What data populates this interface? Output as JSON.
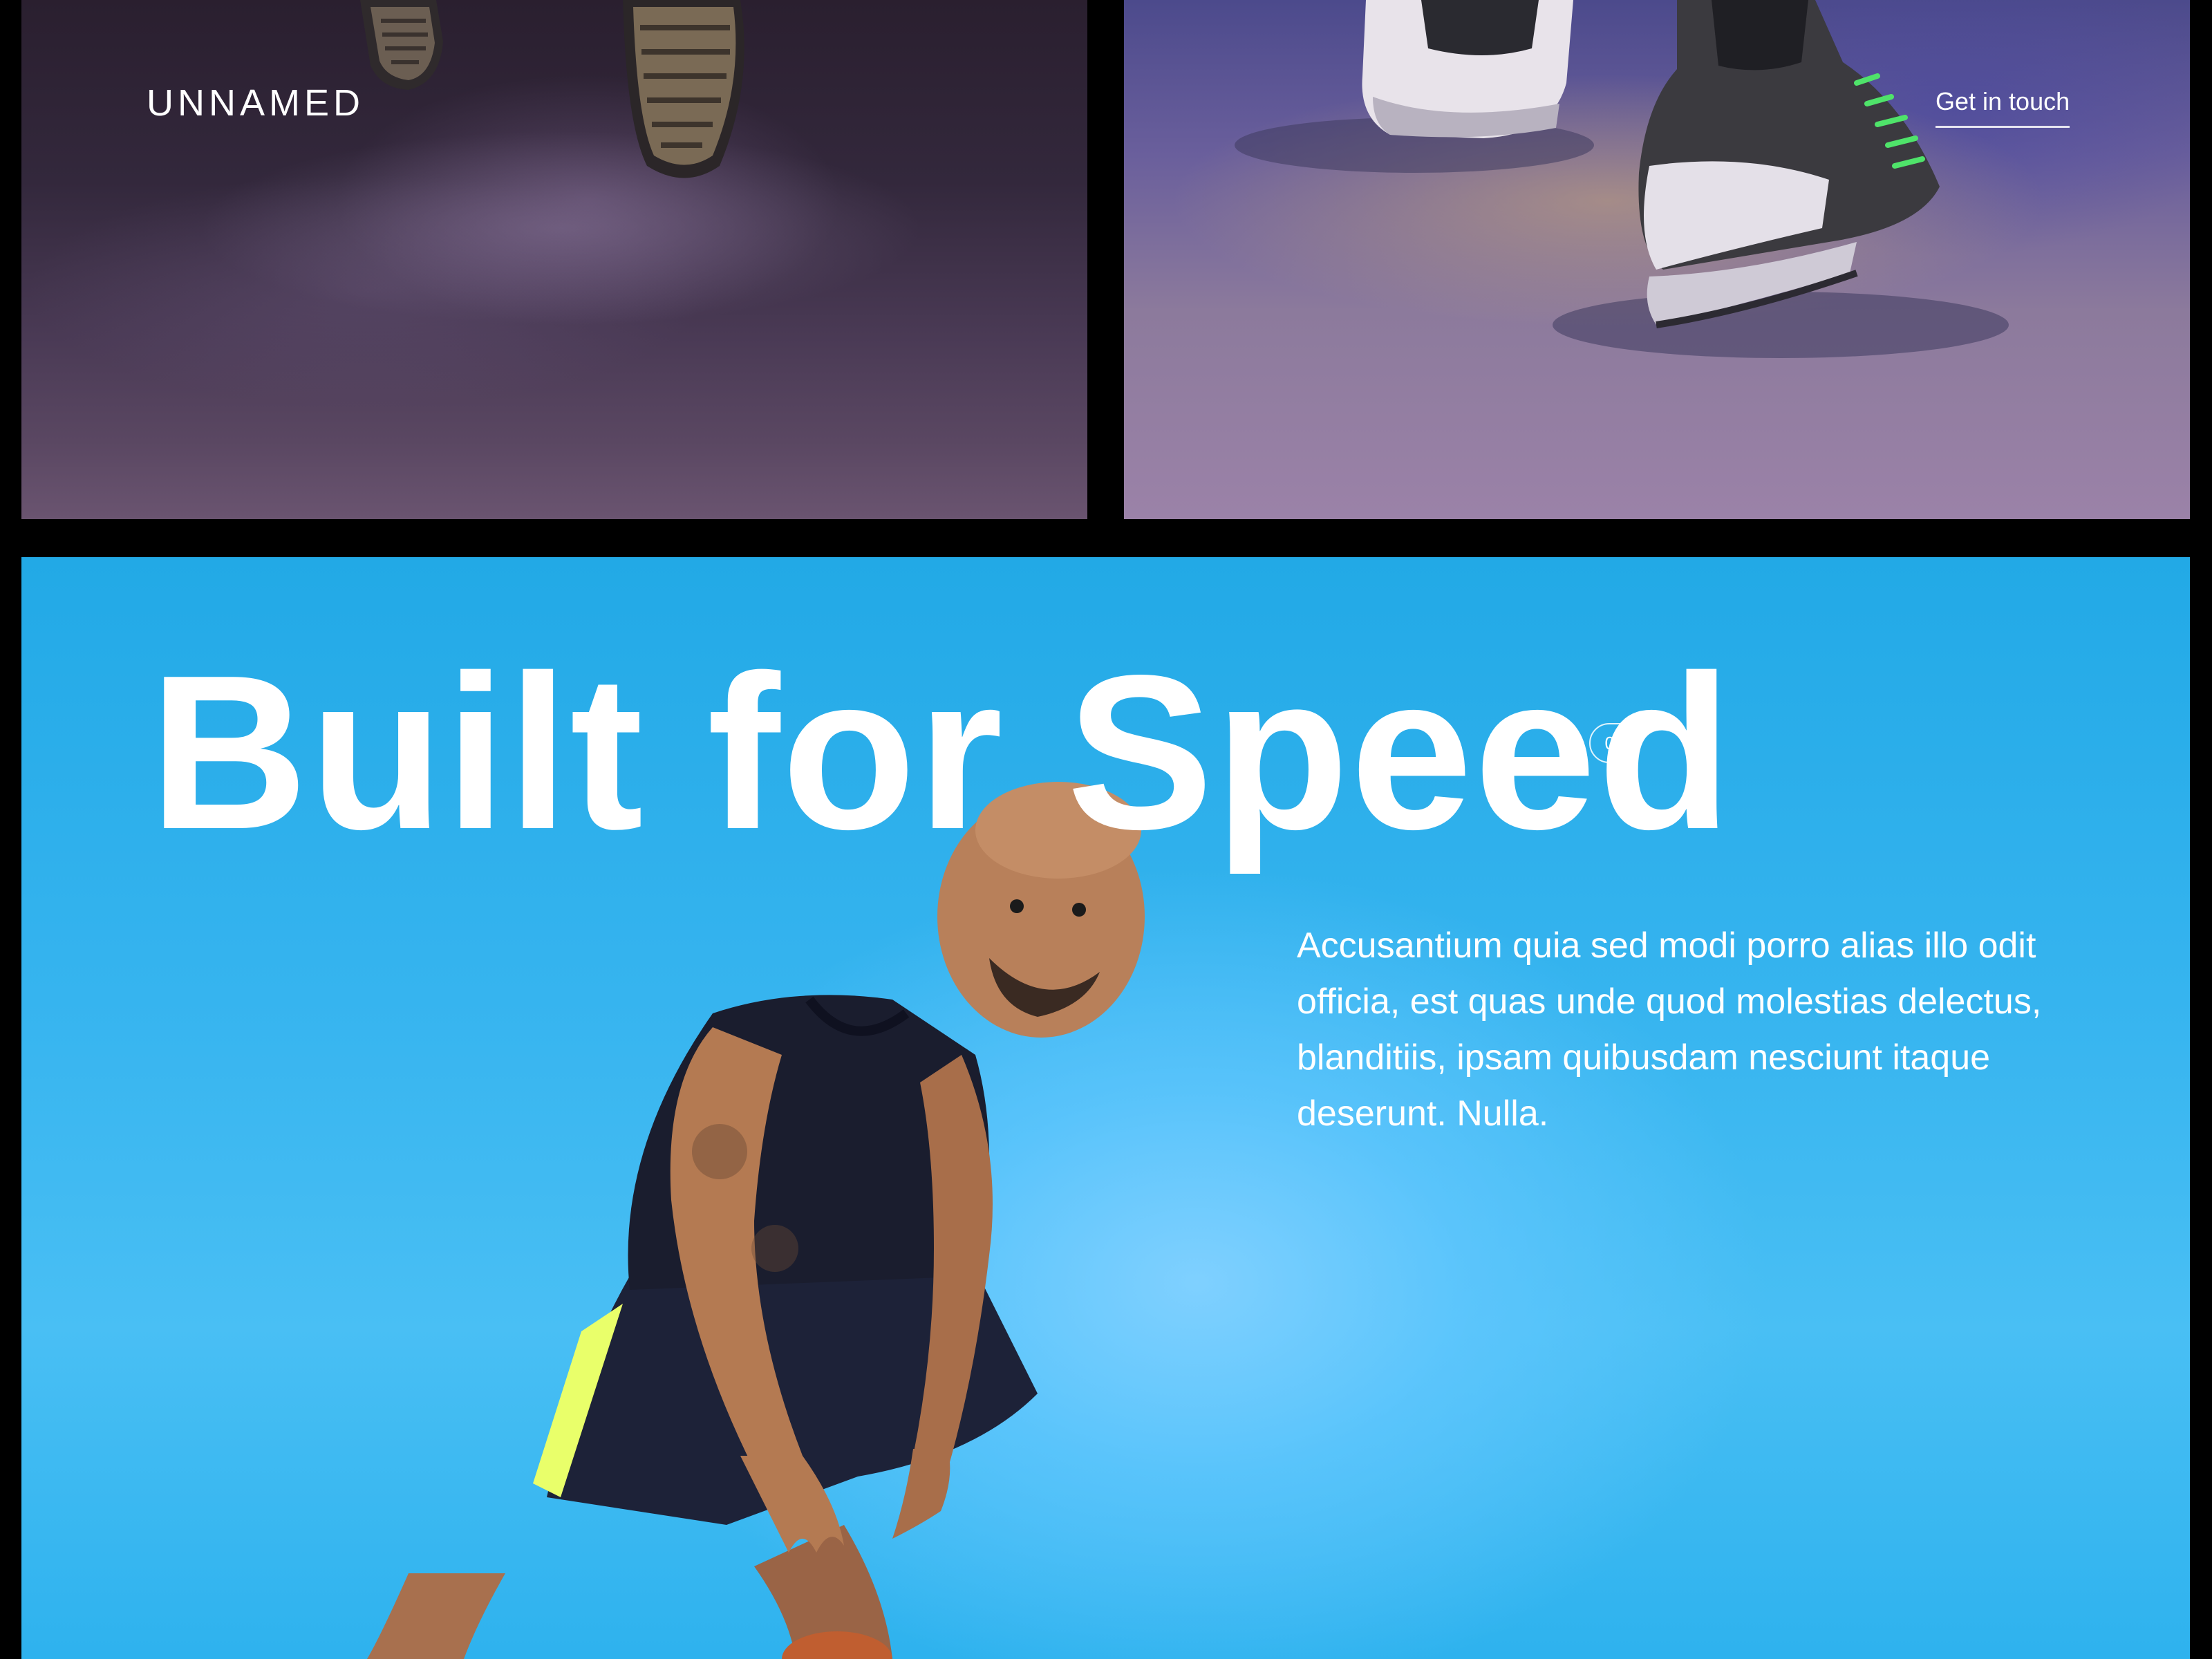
{
  "header": {
    "brand": "UNNAMED",
    "contact_link": "Get in touch"
  },
  "hero": {
    "headline": "Built for Speed",
    "slide_number": "03",
    "description": "Accusantium quia sed modi porro alias illo odit officia, est quas unde quod molestias delectus, blanditiis, ipsam quibusdam nesciunt itaque deserunt. Nulla.",
    "background_color": "#36b4ef"
  },
  "images": {
    "left_panel": "running-shoes-soles-photo",
    "right_panel": "sneakers-walking-photo",
    "hero_figure": "basketball-player-photo"
  }
}
